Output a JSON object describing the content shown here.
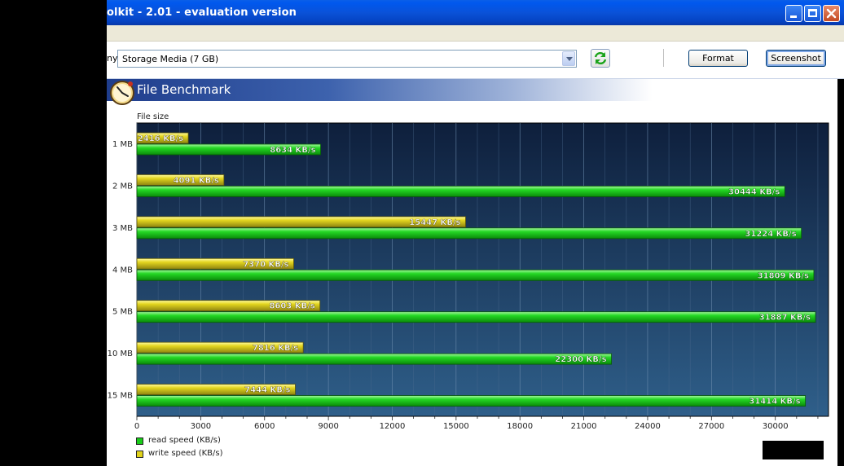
{
  "window": {
    "title": "olkit - 2.01 - evaluation version"
  },
  "toolbar": {
    "drive_label_fragment": "ny",
    "drive_value": "Storage Media (7 GB)",
    "format_label": "Format",
    "screenshot_label": "Screenshot"
  },
  "panel": {
    "title": "File Benchmark"
  },
  "colors": {
    "read": "#19cc19",
    "write": "#e0d21a",
    "plot_bg_top": "#0e1f3c",
    "plot_bg_bottom": "#2f5f8a"
  },
  "chart_data": {
    "type": "bar",
    "orientation": "horizontal",
    "ylabel": "File size",
    "categories": [
      "1 MB",
      "2 MB",
      "3 MB",
      "4 MB",
      "5 MB",
      "10 MB",
      "15 MB"
    ],
    "series": [
      {
        "name": "write speed (KB/s)",
        "values": [
          2416,
          4091,
          15447,
          7370,
          8603,
          7816,
          7444
        ],
        "labels": [
          "2416 KB/s",
          "4091 KB/s",
          "15447 KB/s",
          "7370 KB/s",
          "8603 KB/s",
          "7816 KB/s",
          "7444 KB/s"
        ]
      },
      {
        "name": "read speed (KB/s)",
        "values": [
          8634,
          30444,
          31224,
          31809,
          31887,
          22300,
          31414
        ],
        "labels": [
          "8634 KB/s",
          "30444 KB/s",
          "31224 KB/s",
          "31809 KB/s",
          "31887 KB/s",
          "22300 KB/s",
          "31414 KB/s"
        ]
      }
    ],
    "xticks": [
      "0",
      "3000",
      "6000",
      "9000",
      "12000",
      "15000",
      "18000",
      "21000",
      "24000",
      "27000",
      "30000"
    ],
    "xlim": [
      0,
      32500
    ],
    "grid": true,
    "legend": [
      {
        "label": "read speed (KB/s)",
        "series": 1
      },
      {
        "label": "write speed (KB/s)",
        "series": 0
      }
    ],
    "legend_position": "bottom-left"
  }
}
